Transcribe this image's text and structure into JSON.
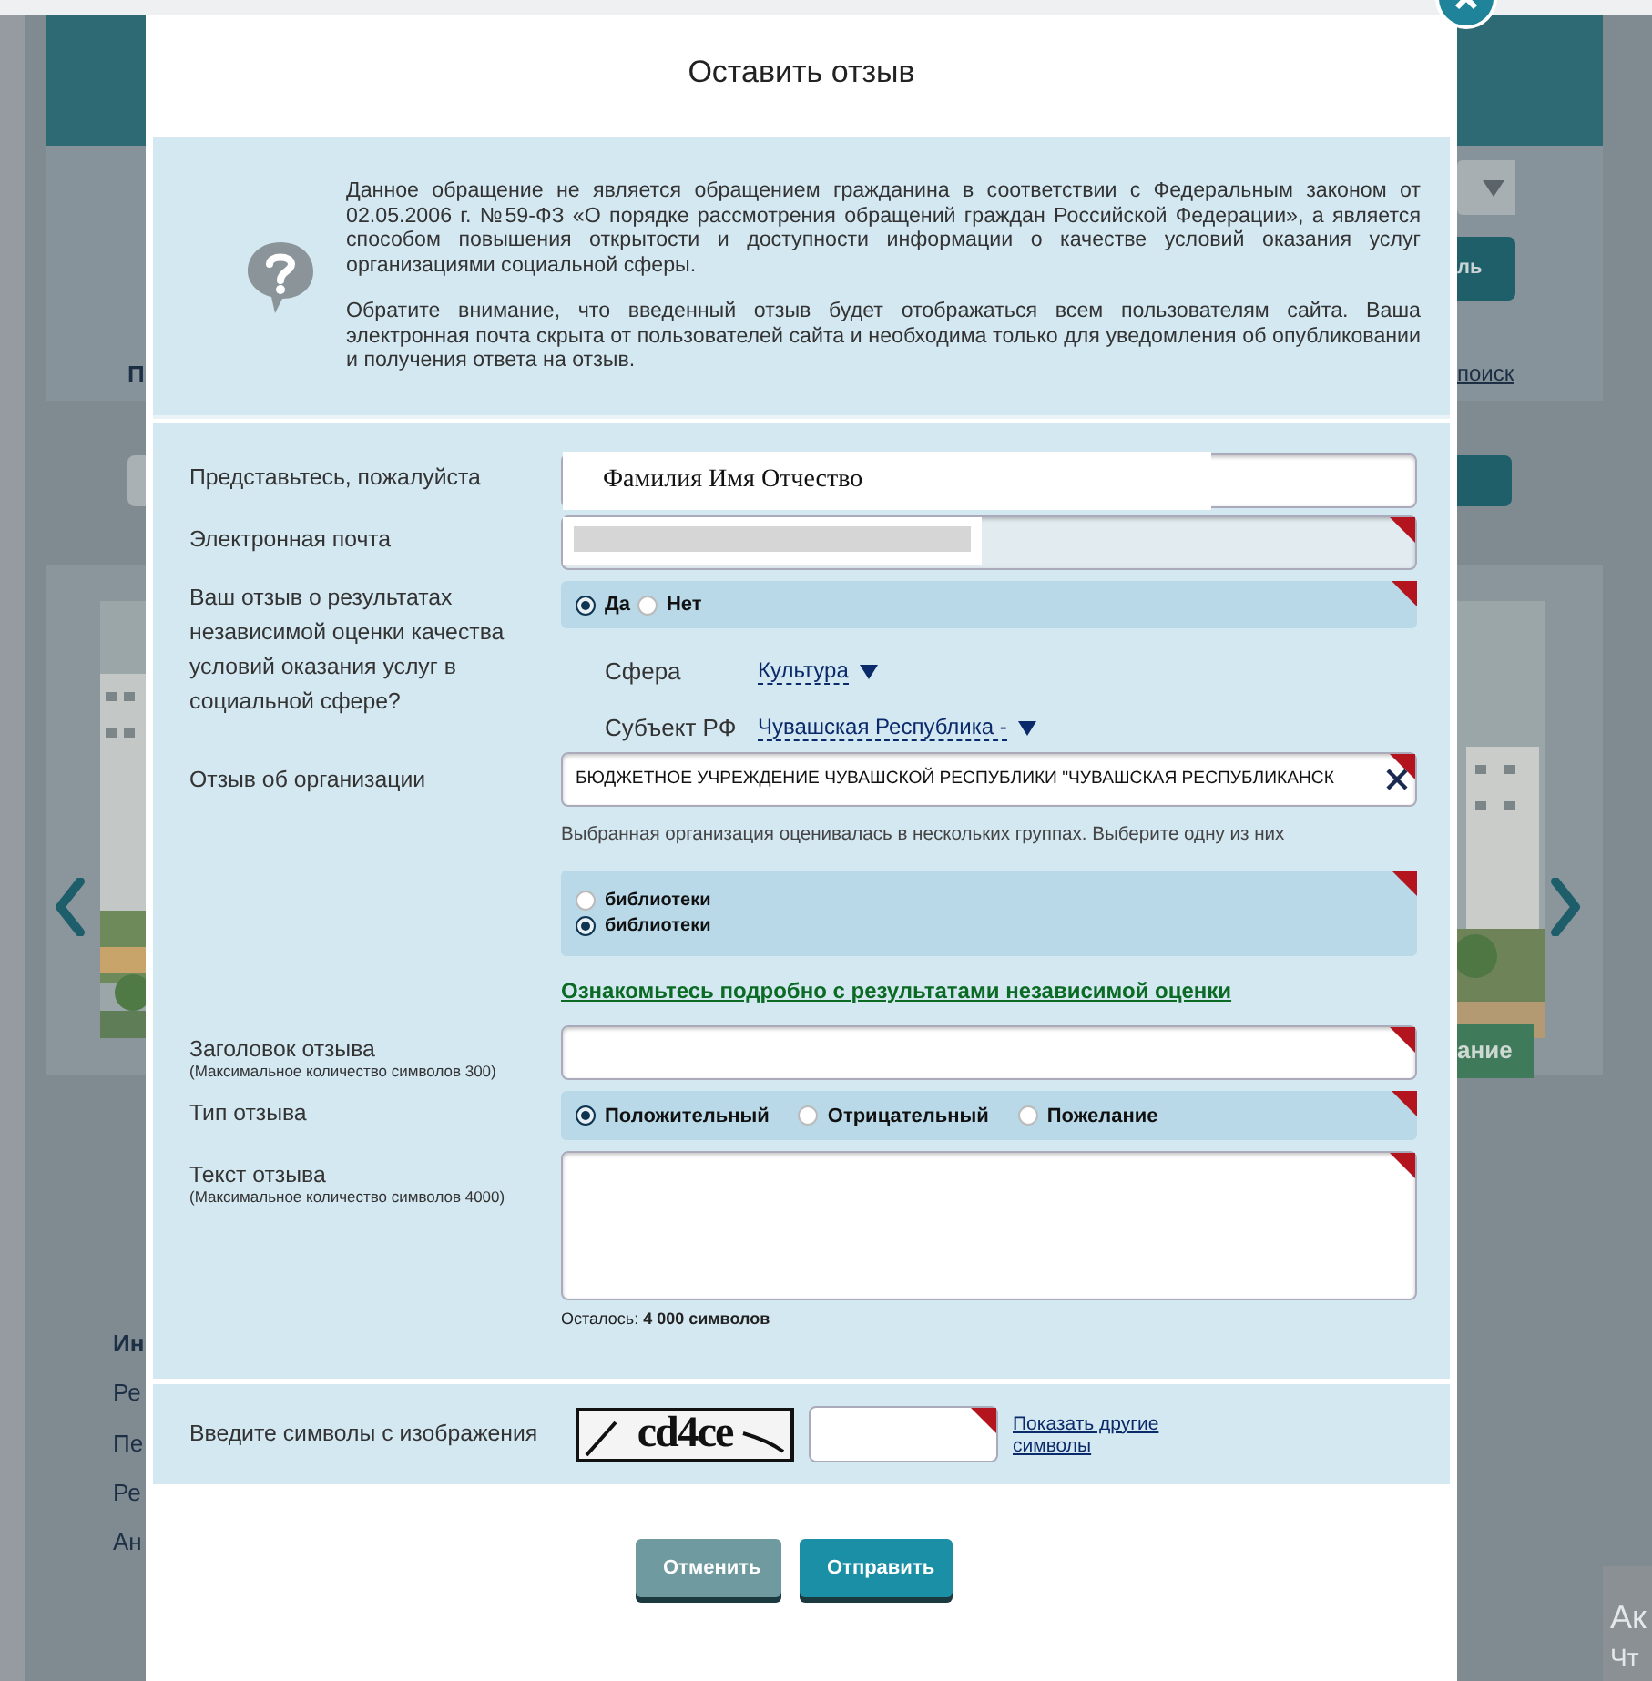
{
  "backdrop": {
    "search_letter": "П",
    "search_link": "поиск",
    "button_fragment": "ль",
    "banner_fragment": "ание",
    "footer_links": [
      "Ин",
      "Ре",
      "Пе",
      "Ре",
      "Ан"
    ],
    "corner_texts": [
      "Ак",
      "Чт"
    ]
  },
  "dialog": {
    "title": "Оставить отзыв",
    "notice": [
      "Данное обращение не является обращением гражданина в соответствии с Федеральным законом от 02.05.2006 г. №59-ФЗ «О порядке рассмотрения обращений граждан Российской Федерации», а является способом повышения открытости и доступности информации о качестве условий оказания услуг организациями социальной сферы.",
      "Обратите внимание, что введенный отзыв будет отображаться всем пользователям сайта. Ваша электронная почта скрыта от пользователей сайта и необходима только для уведомления об опубликовании и получения ответа на отзыв."
    ],
    "form": {
      "name": {
        "label": "Представьтесь, пожалуйста",
        "value": "Фамилия Имя Отчество",
        "required": false
      },
      "email": {
        "label": "Электронная почта",
        "required": true
      },
      "independent_review": {
        "label": "Ваш отзыв о результатах независимой оценки качества условий оказания услуг в социальной сфере?",
        "required": true,
        "options": [
          {
            "label": "Да",
            "selected": true
          },
          {
            "label": "Нет",
            "selected": false
          }
        ]
      },
      "sphere": {
        "label": "Сфера",
        "value": "Культура"
      },
      "region": {
        "label": "Субъект РФ",
        "value": "Чувашская Республика -"
      },
      "organization": {
        "label": "Отзыв об организации",
        "value": "БЮДЖЕТНОЕ УЧРЕЖДЕНИЕ ЧУВАШСКОЙ РЕСПУБЛИКИ \"ЧУВАШСКАЯ РЕСПУБЛИКАНСК",
        "required": true
      },
      "group_hint": "Выбранная организация оценивалась в нескольких группах. Выберите одну из них",
      "groups": {
        "required": true,
        "options": [
          {
            "label": "библиотеки",
            "selected": false
          },
          {
            "label": "библиотеки",
            "selected": true
          }
        ]
      },
      "results_link": "Ознакомьтесь подробно с результатами независимой оценки",
      "review_title": {
        "label": "Заголовок отзыва",
        "note": "(Максимальное количество символов 300)",
        "required": true
      },
      "review_type": {
        "label": "Тип отзыва",
        "required": true,
        "options": [
          {
            "label": "Положительный",
            "selected": true
          },
          {
            "label": "Отрицательный",
            "selected": false
          },
          {
            "label": "Пожелание",
            "selected": false
          }
        ]
      },
      "review_text": {
        "label": "Текст отзыва",
        "note": "(Максимальное количество символов 4000)",
        "required": true
      },
      "remaining": "Осталось: **4 000 символов**"
    },
    "captcha": {
      "label": "Введите символы с изображения",
      "image_text": "cd4ce",
      "required": true,
      "refresh_link": "Показать другие символы"
    },
    "buttons": [
      {
        "label": "Отменить",
        "kind": "cancel"
      },
      {
        "label": "Отправить",
        "kind": "submit"
      }
    ]
  }
}
